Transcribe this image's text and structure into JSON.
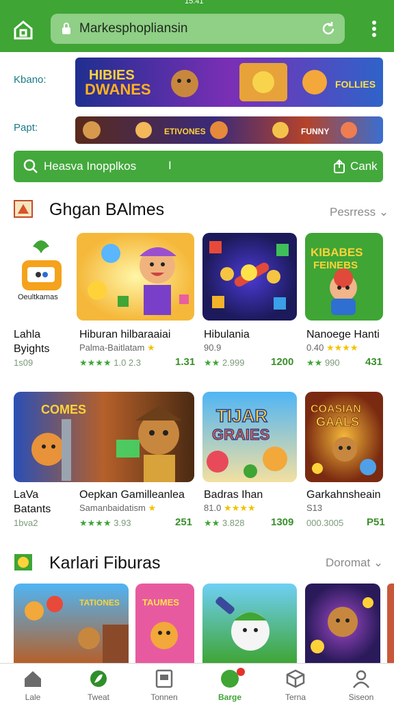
{
  "status_bar": {
    "time": "15:41"
  },
  "browser": {
    "url": "Markesphopliansin",
    "icons": [
      "home-icon",
      "lock-icon",
      "reload-icon",
      "more-vertical-icon"
    ]
  },
  "featured": [
    {
      "label": "Kbano:",
      "banner_text": "HIBIES DWANES"
    },
    {
      "label": "Papt:",
      "banner_text": ""
    }
  ],
  "search": {
    "text": "Heasva Inopplkos",
    "cursor": "I",
    "action": "Cank"
  },
  "sections": [
    {
      "title": "Ghgan BAlmes",
      "more": "Pesrress",
      "apps": [
        {
          "name": [
            "Lahla",
            "Byights"
          ],
          "price": "1s09",
          "tile_text": "Oeultkamas"
        },
        {
          "name": [
            "Hiburan hilbaraaiai"
          ],
          "sub": "Palma-Baitlatam",
          "rating": "1.0 2.3",
          "price": "1.31"
        },
        {
          "name": [
            "Hibulania"
          ],
          "sub": "90.9",
          "rating": "2.999",
          "price": "1200"
        },
        {
          "name": [
            "Nanoege Hanti"
          ],
          "sub": "0.40",
          "rating": "990",
          "price": "431",
          "tile_text": "KIBABES FEINEBS"
        }
      ]
    },
    {
      "title": "",
      "more": "",
      "apps": [
        {
          "name": [
            "LaVa",
            "Batants"
          ],
          "price": "1bva2",
          "tile_text": "COMES"
        },
        {
          "name": [
            "Oepkan Gamilleanlea"
          ],
          "sub": "Samanbaidatism",
          "rating": "3.93",
          "price": "251"
        },
        {
          "name": [
            "Badras Ihan"
          ],
          "sub": "81.0",
          "rating": "3.828",
          "price": "1309",
          "tile_text": "TIJAR GRAIES"
        },
        {
          "name": [
            "Garkahnsheain"
          ],
          "sub": "S13",
          "rating": "000.3005",
          "price": "P51",
          "tile_text": "COASIAN GAALS"
        }
      ]
    },
    {
      "title": "Karlari Fiburas",
      "more": "Doromat",
      "apps": [
        {
          "tile_text": "TATIONES"
        },
        {
          "tile_text": "TAUMES"
        },
        {
          "tile_text": ""
        },
        {
          "tile_text": ""
        }
      ]
    }
  ],
  "bottom_nav": [
    {
      "label": "Lale",
      "icon": "home-icon"
    },
    {
      "label": "Tweat",
      "icon": "leaf-icon"
    },
    {
      "label": "Tonnen",
      "icon": "tablet-icon"
    },
    {
      "label": "Barge",
      "icon": "games-icon",
      "active": true
    },
    {
      "label": "Terna",
      "icon": "box-icon"
    },
    {
      "label": "Siseon",
      "icon": "profile-icon"
    }
  ],
  "colors": {
    "brand": "#3fa535",
    "accent_teal": "#197a86",
    "badge": "#e3332b"
  }
}
